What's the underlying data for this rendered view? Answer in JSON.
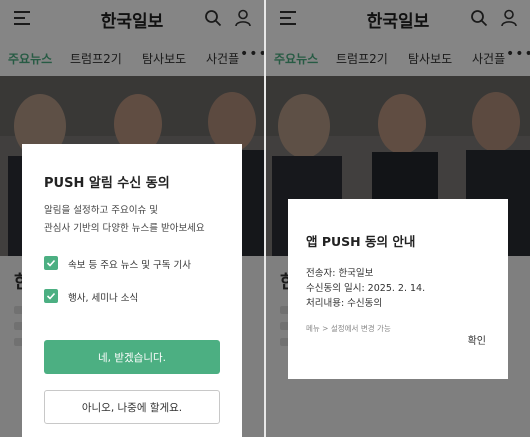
{
  "app": {
    "logo_text": "한국일보"
  },
  "tabs": {
    "left": [
      "주요뉴스",
      "트럼프2기",
      "탐사보도",
      "사건플"
    ],
    "right": [
      "주요뉴스",
      "트럼프2기",
      "탐사보도",
      "사건플"
    ],
    "more": "•••"
  },
  "background": {
    "headline_fragment": "한"
  },
  "colors": {
    "accent": "#4caf82",
    "overlay": "rgba(0,0,0,0.48)"
  },
  "icons": [
    "menu-icon",
    "search-icon",
    "user-icon",
    "check-icon"
  ],
  "push_consent_dialog": {
    "title": "PUSH 알림 수신 동의",
    "description_line1": "알림을 설정하고 주요이슈 및",
    "description_line2": "관심사 기반의 다양한 뉴스를 받아보세요",
    "options": [
      {
        "label": "속보 등 주요 뉴스 및 구독 기사",
        "checked": true
      },
      {
        "label": "행사, 세미나 소식",
        "checked": true
      }
    ],
    "accept_button": "네, 받겠습니다.",
    "decline_button": "아니오, 나중에 할게요."
  },
  "push_info_dialog": {
    "title": "앱 PUSH 동의 안내",
    "sender": "전송자: 한국일보",
    "date": "수신동의 일시: 2025. 2. 14.",
    "result": "처리내용: 수신동의",
    "note": "메뉴 > 설정에서 변경 가능",
    "confirm_button": "확인"
  }
}
